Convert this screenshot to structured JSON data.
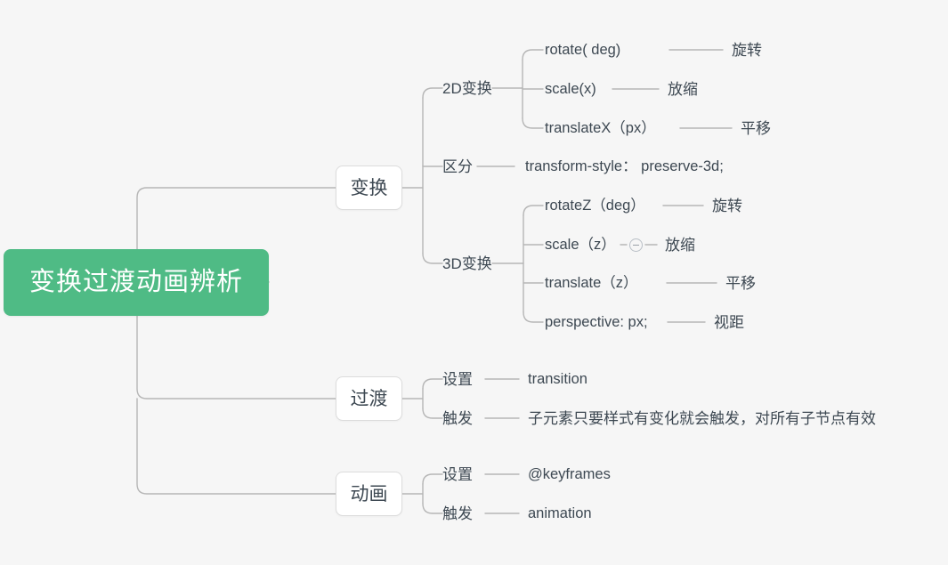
{
  "canvas": {
    "background": "#f6f6f6",
    "line_color": "#b6b6b6",
    "text_color": "#3d4852",
    "root_color": "#4fbb85",
    "node_border_color": "#dcdcdc"
  },
  "root": {
    "label": "变换过渡动画辨析"
  },
  "branches": [
    {
      "id": "transform",
      "label": "变换",
      "children": [
        {
          "id": "transform-2d",
          "label": "2D变换",
          "children": [
            {
              "label": "rotate( deg)",
              "note": "旋转"
            },
            {
              "label": "scale(x)",
              "note": "放缩"
            },
            {
              "label": "translateX（px）",
              "note": "平移"
            }
          ]
        },
        {
          "id": "transform-distinguish",
          "label": "区分",
          "note": "transform-style： preserve-3d;",
          "children": []
        },
        {
          "id": "transform-3d",
          "label": "3D变换",
          "children": [
            {
              "label": "rotateZ（deg）",
              "note": "旋转"
            },
            {
              "label": "scale（z）",
              "note": "放缩",
              "collapse_badge": true
            },
            {
              "label": "translate（z）",
              "note": "平移"
            },
            {
              "label": "perspective: px;",
              "note": "视距"
            }
          ]
        }
      ]
    },
    {
      "id": "transition",
      "label": "过渡",
      "children": [
        {
          "id": "transition-set",
          "label": "设置",
          "note": "transition"
        },
        {
          "id": "transition-trigger",
          "label": "触发",
          "note": "子元素只要样式有变化就会触发，对所有子节点有效"
        }
      ]
    },
    {
      "id": "animation",
      "label": "动画",
      "children": [
        {
          "id": "animation-set",
          "label": "设置",
          "note": "@keyframes"
        },
        {
          "id": "animation-trigger",
          "label": "触发",
          "note": "animation"
        }
      ]
    }
  ]
}
